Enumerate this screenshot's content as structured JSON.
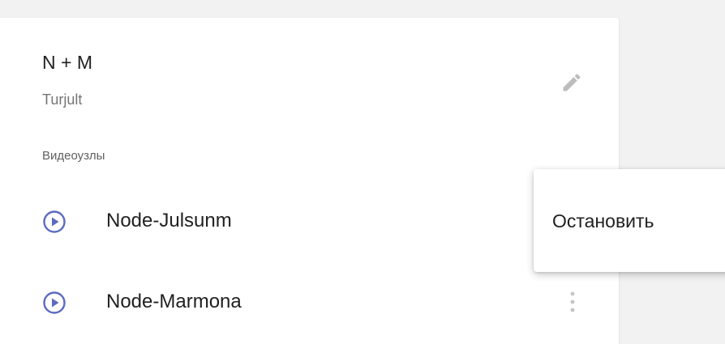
{
  "card": {
    "title": "N + M",
    "subtitle": "Turjult",
    "section_label": "Видеоузлы",
    "edit_icon": "pencil-icon"
  },
  "nodes": [
    {
      "label": "Node-Julsunm",
      "icon": "play-circle-icon"
    },
    {
      "label": "Node-Marmona",
      "icon": "play-circle-icon"
    }
  ],
  "context_menu": {
    "items": [
      {
        "label": "Остановить"
      }
    ]
  },
  "colors": {
    "accent": "#5c6bc0",
    "icon_gray": "#bdbdbd",
    "text_primary": "#212121",
    "text_secondary": "#757575"
  }
}
